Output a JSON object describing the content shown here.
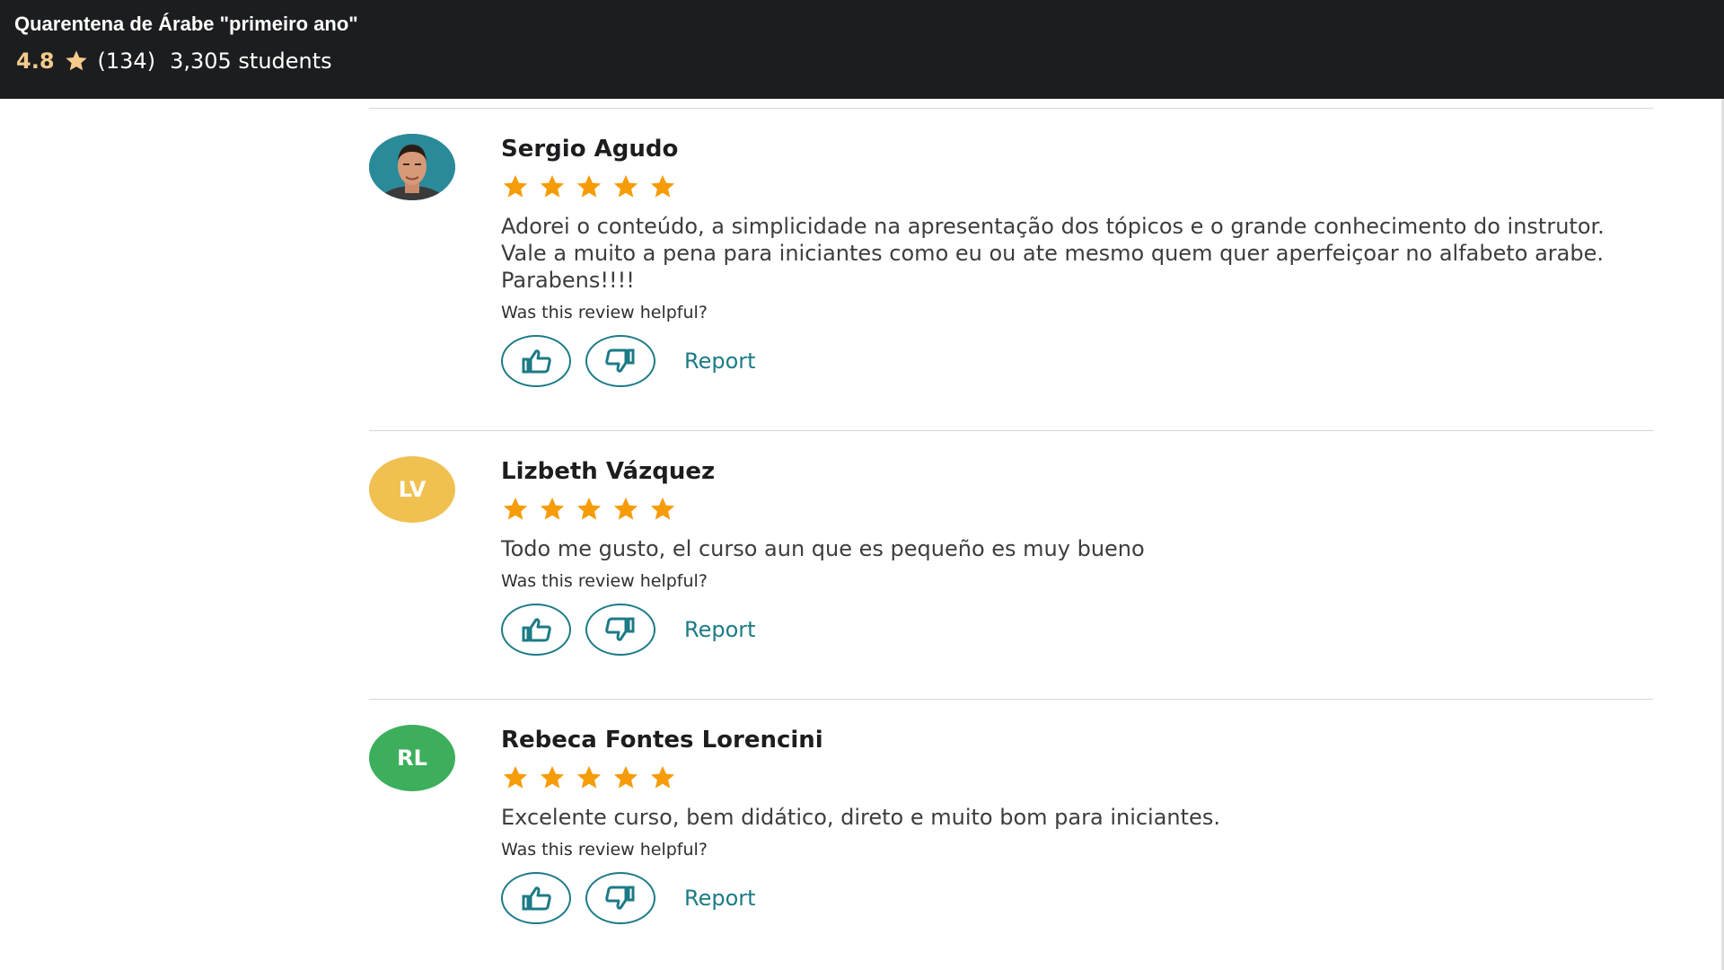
{
  "header": {
    "course_title": "Quarentena de Árabe \"primeiro ano\"",
    "rating": "4.8",
    "rating_icon": "star-icon",
    "review_count": "(134)",
    "students": "3,305 students"
  },
  "colors": {
    "header_bg": "#1c1d1f",
    "rating_gold": "#f3ca8c",
    "star_orange": "#f69c08",
    "accent_teal": "#1c7b86",
    "avatar_lv": "#f0c050",
    "avatar_rl": "#3cae5c"
  },
  "reviews": [
    {
      "name": "Sergio Agudo",
      "avatar_type": "photo",
      "rating": 5,
      "text": "Adorei o conteúdo, a simplicidade na apresentação dos tópicos e o grande conhecimento do instrutor. Vale a muito a pena para iniciantes como eu ou ate mesmo quem quer aperfeiçoar no alfabeto arabe. Parabens!!!!",
      "helpful_prompt": "Was this review helpful?",
      "report_label": "Report"
    },
    {
      "name": "Lizbeth Vázquez",
      "initials": "LV",
      "rating": 5,
      "text": "Todo me gusto, el curso aun que es pequeño es muy bueno",
      "helpful_prompt": "Was this review helpful?",
      "report_label": "Report"
    },
    {
      "name": "Rebeca Fontes Lorencini",
      "initials": "RL",
      "rating": 5,
      "text": "Excelente curso, bem didático, direto e muito bom para iniciantes.",
      "helpful_prompt": "Was this review helpful?",
      "report_label": "Report"
    }
  ]
}
